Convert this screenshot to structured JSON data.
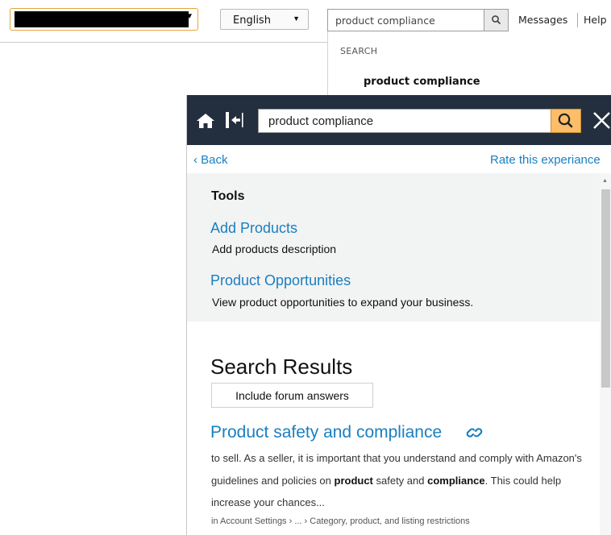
{
  "topbar": {
    "language_label": "English",
    "search_value": "product compliance",
    "messages_label": "Messages",
    "help_label": "Help"
  },
  "search_dropdown": {
    "heading": "SEARCH",
    "item": "product compliance"
  },
  "help_panel": {
    "search_value": "product compliance",
    "back_label": "Back",
    "rate_label": "Rate this experiance",
    "tools": {
      "title": "Tools",
      "items": [
        {
          "label": "Add Products",
          "description": "Add products description"
        },
        {
          "label": "Product Opportunities",
          "description": "View product opportunities to expand your business."
        }
      ]
    },
    "results": {
      "title": "Search Results",
      "forum_button": "Include forum answers",
      "items": [
        {
          "title": "Product safety and compliance",
          "snippet_parts": [
            "to sell. As a seller, it is important that you understand and comply with Amazon's guidelines and policies on ",
            "product",
            " safety and ",
            "compliance",
            ". This could help increase your chances..."
          ],
          "breadcrumb": "in Account Settings › ... › Category, product, and listing restrictions"
        }
      ]
    }
  },
  "colors": {
    "header_bg": "#232f3e",
    "link": "#1a7fc1",
    "search_button": "#febd69",
    "account_border": "#e8a33d"
  },
  "icons": [
    "home-icon",
    "collapse-panel-icon",
    "search-icon",
    "close-icon",
    "link-icon"
  ]
}
